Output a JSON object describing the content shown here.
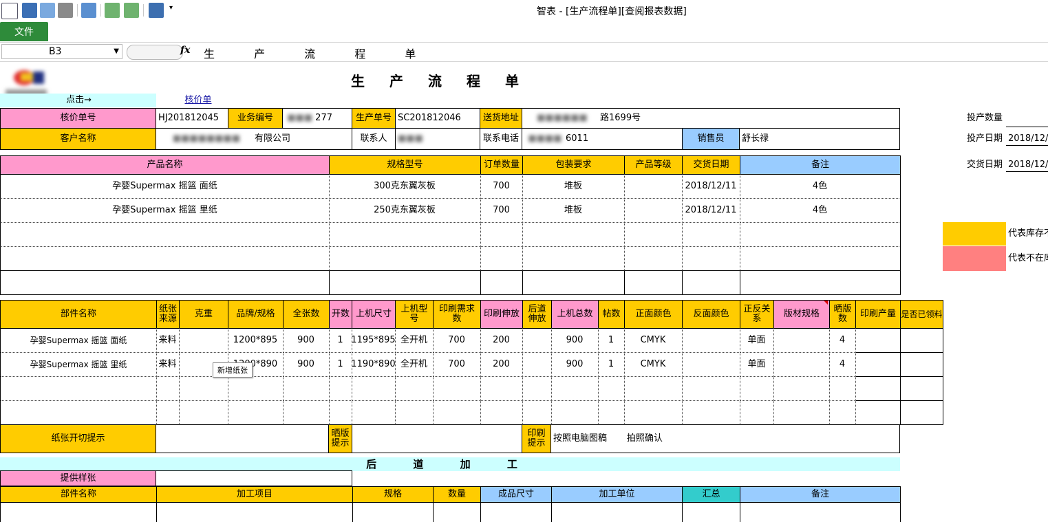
{
  "window": {
    "title": "智表 - [生产流程单][查阅报表数据]"
  },
  "ribbon": {
    "file_tab": "文件"
  },
  "formula_bar": {
    "cell_ref": "B3",
    "fx": "fx",
    "formula": "生 产 流 程 单"
  },
  "sheet": {
    "title": "生产流程单",
    "click_hint": "点击→",
    "link_quote": "核价单",
    "tooltip": "新增纸张",
    "header": {
      "quote_no_label": "核价单号",
      "quote_no": "HJ201812045",
      "biz_no_label": "业务编号",
      "biz_no": "277",
      "prod_no_label": "生产单号",
      "prod_no": "SC201812046",
      "addr_label": "送货地址",
      "addr": "路1699号",
      "customer_label": "客户名称",
      "customer": "有限公司",
      "contact_label": "联系人",
      "phone_label": "联系电话",
      "phone": "6011",
      "sales_label": "销售员",
      "sales": "舒长禄"
    },
    "side": {
      "qty_label": "投产数量",
      "prod_date_label": "投产日期",
      "prod_date": "2018/12/",
      "deliv_date_label": "交货日期",
      "deliv_date": "2018/12/",
      "legend_yellow": "代表库存不",
      "legend_salmon": "代表不在库"
    },
    "products": {
      "headers": [
        "产品名称",
        "规格型号",
        "订单数量",
        "包装要求",
        "产品等级",
        "交货日期",
        "备注"
      ],
      "rows": [
        [
          "孕婴Supermax 摇篮  面纸",
          "300克东翼灰板",
          "700",
          "堆板",
          "",
          "2018/12/11",
          "4色"
        ],
        [
          "孕婴Supermax 摇篮  里纸",
          "250克东翼灰板",
          "700",
          "堆板",
          "",
          "2018/12/11",
          "4色"
        ]
      ]
    },
    "parts": {
      "headers": [
        "部件名称",
        "纸张来源",
        "克重",
        "品牌/规格",
        "全张数",
        "开数",
        "上机尺寸",
        "上机型号",
        "印刷需求数",
        "印刷伸放",
        "后道伸放",
        "上机总数",
        "帖数",
        "正面颜色",
        "反面颜色",
        "正反关系",
        "版材规格",
        "晒版数",
        "印刷产量",
        "是否已领料"
      ],
      "rows": [
        [
          "孕婴Supermax 摇篮  面纸",
          "来料",
          "",
          "1200*895",
          "900",
          "1",
          "1195*895",
          "全开机",
          "700",
          "200",
          "",
          "900",
          "1",
          "CMYK",
          "",
          "单面",
          "",
          "4",
          "",
          ""
        ],
        [
          "孕婴Supermax 摇篮  里纸",
          "来料",
          "",
          "1200*890",
          "900",
          "1",
          "1190*890",
          "全开机",
          "700",
          "200",
          "",
          "900",
          "1",
          "CMYK",
          "",
          "单面",
          "",
          "4",
          "",
          ""
        ]
      ]
    },
    "cut_hint_label": "纸张开切提示",
    "plate_hint_label": "晒版提示",
    "print_hint_label": "印刷提示",
    "print_hint": "按照电脑图稿       拍照确认",
    "post": {
      "title": "后 道 加 工",
      "sample_label": "提供样张",
      "headers": [
        "部件名称",
        "加工项目",
        "规格",
        "数量",
        "成品尺寸",
        "加工单位",
        "汇总",
        "备注"
      ]
    }
  },
  "colors": {
    "pink": "#ff99cc",
    "yellow": "#ffcc00",
    "blue": "#99ccff",
    "cyan": "#ccffff",
    "teal": "#33cccc",
    "salmon": "#ff8080",
    "file_green": "#2e8b3a"
  }
}
